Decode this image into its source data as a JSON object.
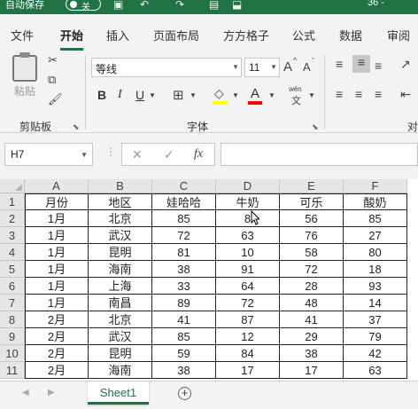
{
  "titlebar": {
    "autosave_label": "自动保存",
    "toggle_state": "关",
    "zoom_text": "36 -"
  },
  "ribbon_tabs": [
    "文件",
    "开始",
    "插入",
    "页面布局",
    "方方格子",
    "公式",
    "数据",
    "审阅"
  ],
  "active_tab": "开始",
  "clipboard": {
    "paste_label": "粘贴",
    "group_label": "剪贴板"
  },
  "font": {
    "name": "等线",
    "size": "11",
    "grow": "A",
    "shrink": "A",
    "bold": "B",
    "italic": "I",
    "underline": "U",
    "font_color_letter": "A",
    "phonetic_top": "wén",
    "phonetic_bottom": "文",
    "group_label": "字体"
  },
  "align_group_fragment": "对",
  "formula_bar": {
    "name_box": "H7",
    "fx": "fx",
    "cancel": "✕",
    "enter": "✓",
    "value": ""
  },
  "colors": {
    "excel_green": "#217346",
    "highlight_yellow": "#ffff00",
    "font_red": "#ff0000"
  },
  "column_letters": [
    "A",
    "B",
    "C",
    "D",
    "E",
    "F"
  ],
  "row_numbers": [
    "1",
    "2",
    "3",
    "4",
    "5",
    "6",
    "7",
    "8",
    "9",
    "10",
    "11"
  ],
  "table": {
    "headers": [
      "月份",
      "地区",
      "娃哈哈",
      "牛奶",
      "可乐",
      "酸奶"
    ],
    "rows": [
      [
        "1月",
        "北京",
        "85",
        "8",
        "56",
        "85"
      ],
      [
        "1月",
        "武汉",
        "72",
        "63",
        "76",
        "27"
      ],
      [
        "1月",
        "昆明",
        "81",
        "10",
        "58",
        "80"
      ],
      [
        "1月",
        "海南",
        "38",
        "91",
        "72",
        "18"
      ],
      [
        "1月",
        "上海",
        "33",
        "64",
        "28",
        "93"
      ],
      [
        "1月",
        "南昌",
        "89",
        "72",
        "48",
        "14"
      ],
      [
        "2月",
        "北京",
        "41",
        "87",
        "41",
        "37"
      ],
      [
        "2月",
        "武汉",
        "85",
        "12",
        "29",
        "79"
      ],
      [
        "2月",
        "昆明",
        "59",
        "84",
        "38",
        "42"
      ],
      [
        "2月",
        "海南",
        "38",
        "17",
        "17",
        "63"
      ]
    ]
  },
  "sheets": {
    "active": "Sheet1",
    "add": "+"
  }
}
